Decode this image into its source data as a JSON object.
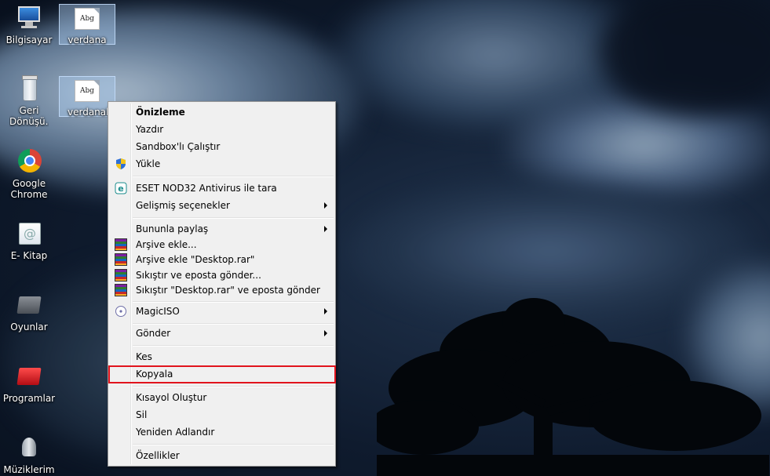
{
  "desktop": {
    "icons": [
      {
        "label": "Bilgisayar",
        "icon": "computer-icon"
      },
      {
        "label": "verdana",
        "icon": "font-file-icon",
        "preview": "Abg"
      },
      {
        "label": "Geri Dönüşü...",
        "icon": "recycle-bin-icon"
      },
      {
        "label": "verdanab",
        "icon": "font-file-icon",
        "preview": "Abg"
      },
      {
        "label": "Google Chrome",
        "icon": "chrome-icon"
      },
      {
        "label": "E- Kitap",
        "icon": "ebook-folder-icon"
      },
      {
        "label": "Oyunlar",
        "icon": "games-folder-icon"
      },
      {
        "label": "Programlar",
        "icon": "programs-folder-icon"
      },
      {
        "label": "Müziklerim",
        "icon": "music-folder-icon"
      }
    ]
  },
  "context_menu": {
    "items": [
      {
        "label": "Önizleme",
        "bold": true
      },
      {
        "label": "Yazdır"
      },
      {
        "label": "Sandbox'lı Çalıştır"
      },
      {
        "label": "Yükle",
        "icon": "uac-shield-icon"
      },
      {
        "label": "ESET NOD32 Antivirus ile tara",
        "icon": "eset-icon"
      },
      {
        "label": "Gelişmiş seçenekler",
        "submenu": true
      },
      {
        "label": "Bununla paylaş",
        "submenu": true
      },
      {
        "label": "Arşive ekle...",
        "icon": "winrar-icon"
      },
      {
        "label": "Arşive ekle \"Desktop.rar\"",
        "icon": "winrar-icon"
      },
      {
        "label": "Sıkıştır ve eposta gönder...",
        "icon": "winrar-icon"
      },
      {
        "label": "Sıkıştır \"Desktop.rar\" ve eposta gönder",
        "icon": "winrar-icon"
      },
      {
        "label": "MagicISO",
        "icon": "magiciso-icon",
        "submenu": true
      },
      {
        "label": "Gönder",
        "submenu": true
      },
      {
        "label": "Kes"
      },
      {
        "label": "Kopyala",
        "highlighted": true
      },
      {
        "label": "Kısayol Oluştur"
      },
      {
        "label": "Sil"
      },
      {
        "label": "Yeniden Adlandır"
      },
      {
        "label": "Özellikler"
      }
    ],
    "highlight_color": "#e1141d"
  }
}
